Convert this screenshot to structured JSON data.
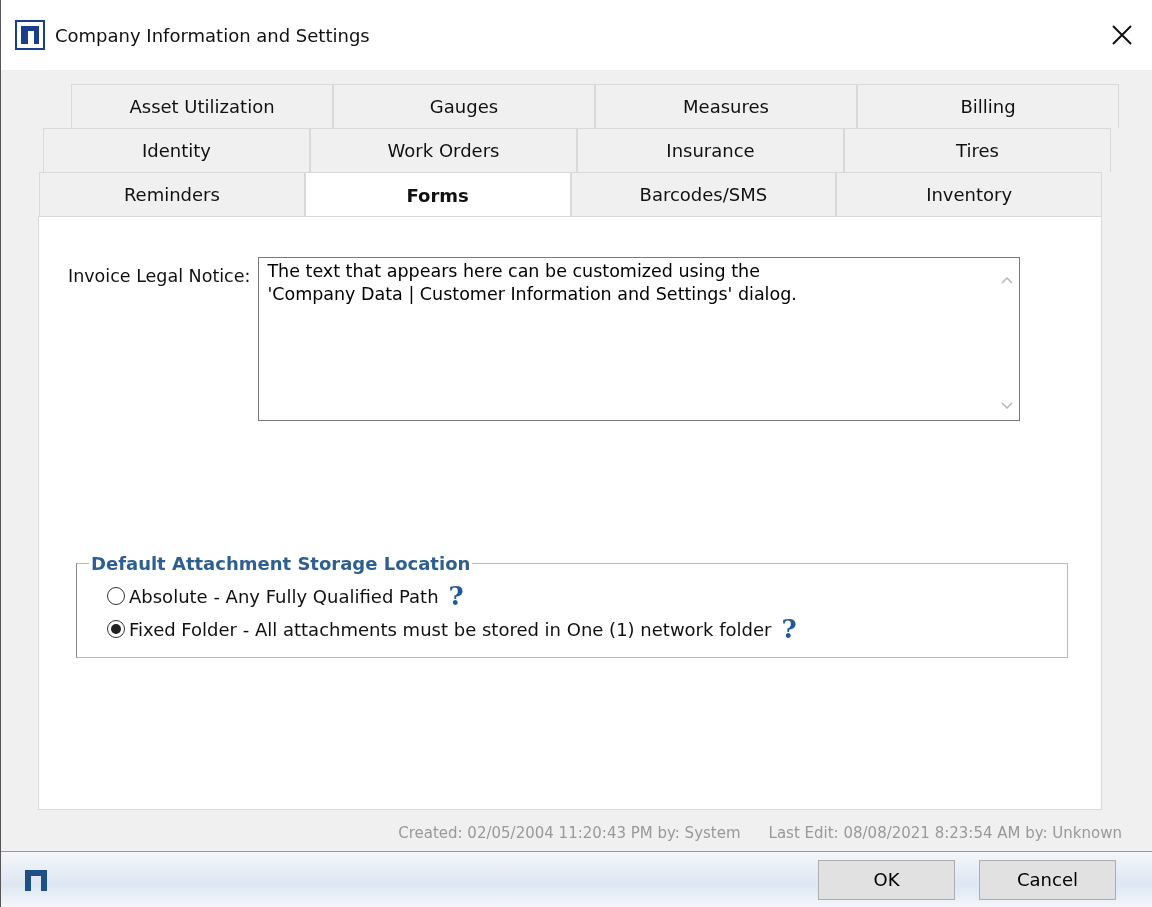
{
  "window": {
    "title": "Company Information and Settings"
  },
  "tab_rows": [
    [
      {
        "label": "Asset Utilization",
        "selected": false
      },
      {
        "label": "Gauges",
        "selected": false
      },
      {
        "label": "Measures",
        "selected": false
      },
      {
        "label": "Billing",
        "selected": false
      }
    ],
    [
      {
        "label": "Identity",
        "selected": false
      },
      {
        "label": "Work Orders",
        "selected": false
      },
      {
        "label": "Insurance",
        "selected": false
      },
      {
        "label": "Tires",
        "selected": false
      }
    ],
    [
      {
        "label": "Reminders",
        "selected": false
      },
      {
        "label": "Forms",
        "selected": true
      },
      {
        "label": "Barcodes/SMS",
        "selected": false
      },
      {
        "label": "Inventory",
        "selected": false
      }
    ]
  ],
  "invoice_legal_notice": {
    "label": "Invoice Legal Notice:",
    "value": "The text that appears here can be customized using the\n'Company Data | Customer Information and Settings' dialog."
  },
  "storage_location": {
    "legend": "Default Attachment Storage Location",
    "options": [
      {
        "label": "Absolute - Any Fully Qualified Path",
        "selected": false,
        "help": "?"
      },
      {
        "label": "Fixed Folder - All attachments must be stored in One (1) network folder",
        "selected": true,
        "help": "?"
      }
    ]
  },
  "footer": {
    "created": "Created: 02/05/2004 11:20:43 PM by: System",
    "last_edit": "Last Edit: 08/08/2021 8:23:54 AM by: Unknown"
  },
  "buttons": [
    {
      "label": "OK"
    },
    {
      "label": "Cancel"
    }
  ]
}
